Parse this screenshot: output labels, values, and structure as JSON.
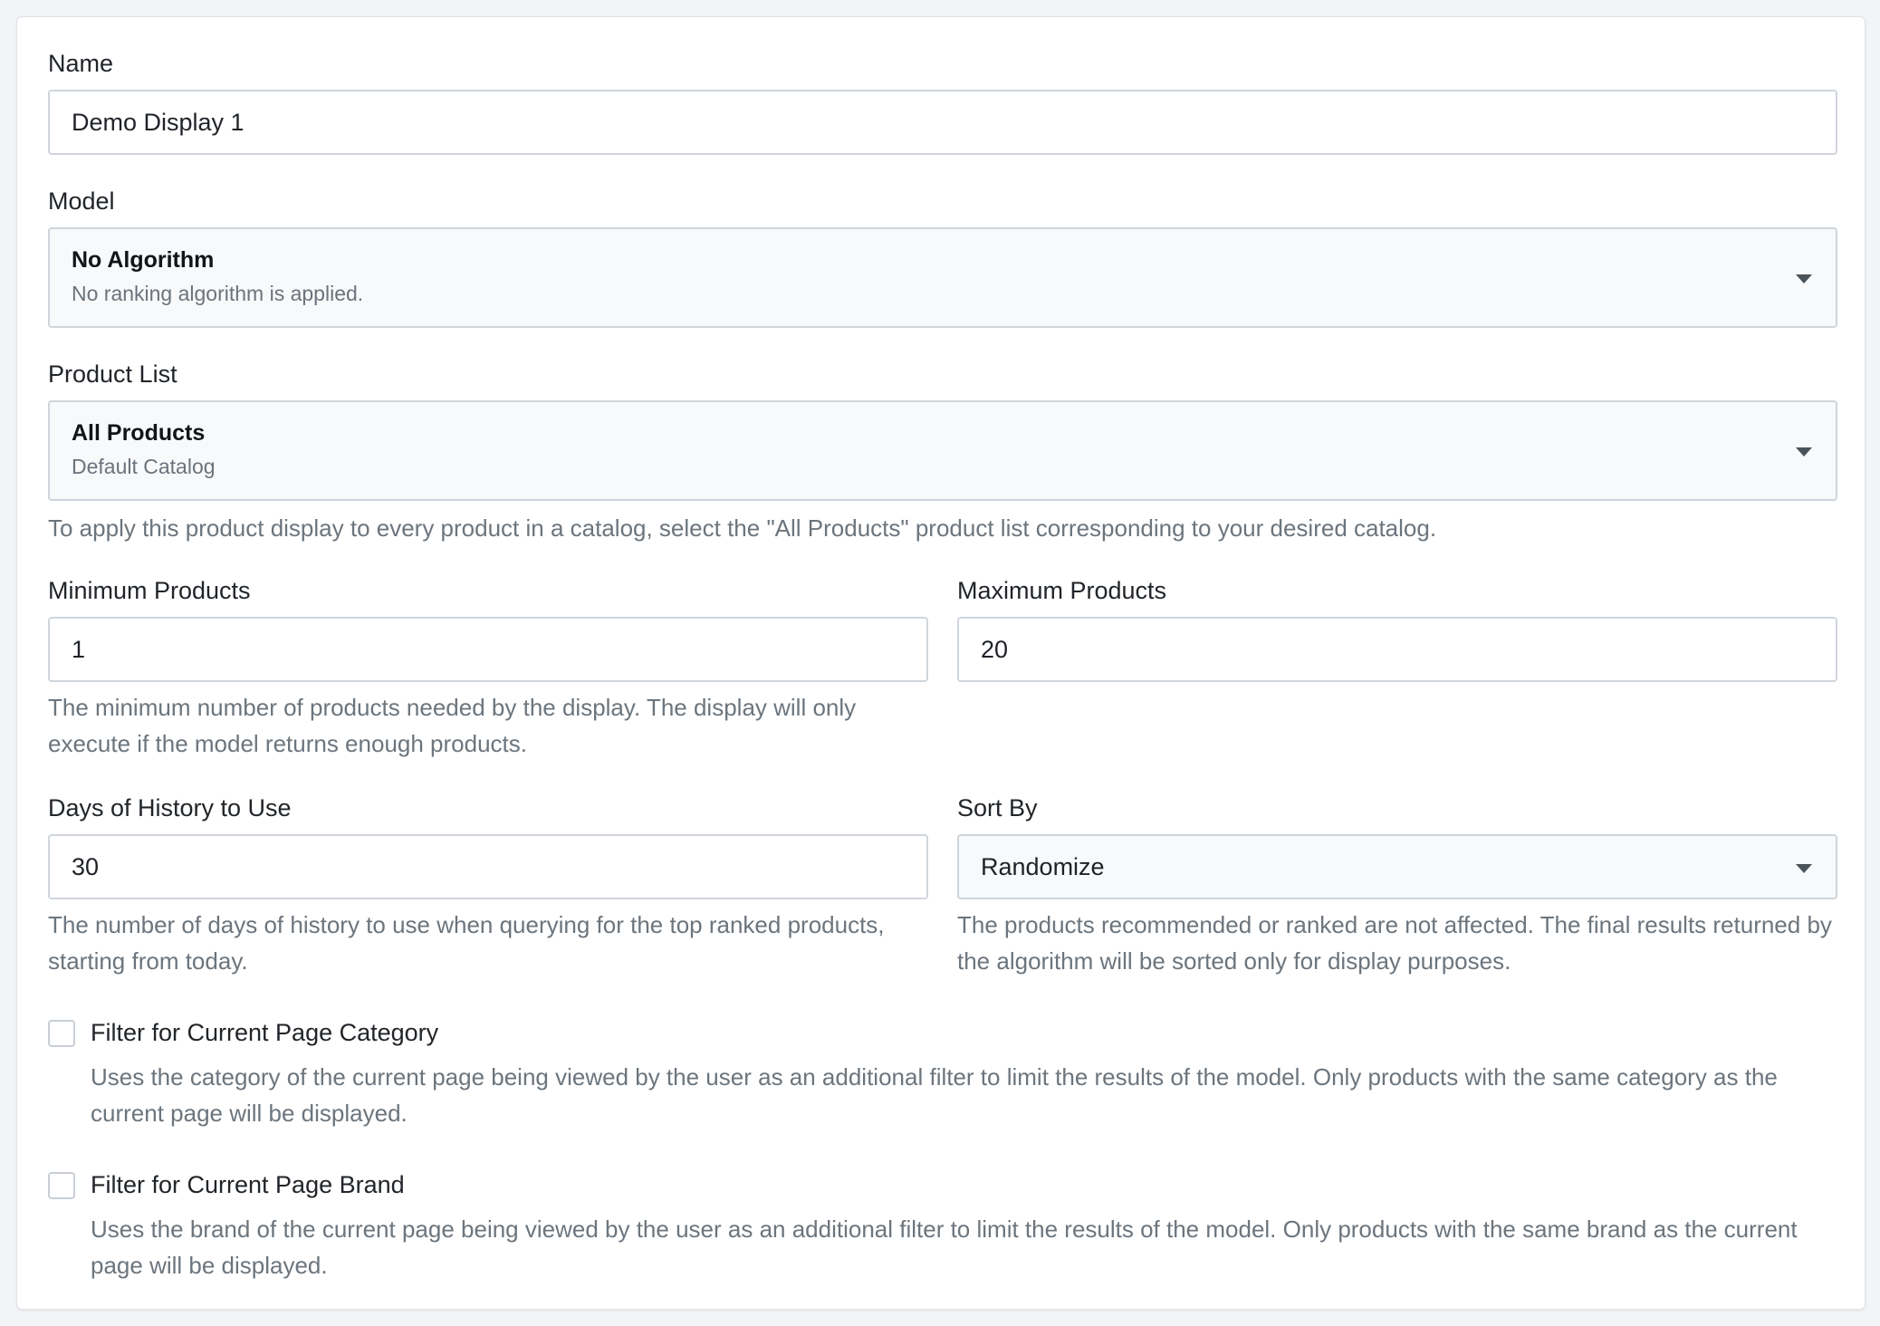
{
  "form": {
    "name": {
      "label": "Name",
      "value": "Demo Display 1"
    },
    "model": {
      "label": "Model",
      "selected_title": "No Algorithm",
      "selected_subtitle": "No ranking algorithm is applied."
    },
    "product_list": {
      "label": "Product List",
      "selected_title": "All Products",
      "selected_subtitle": "Default Catalog",
      "help": "To apply this product display to every product in a catalog, select the \"All Products\" product list corresponding to your desired catalog."
    },
    "min_products": {
      "label": "Minimum Products",
      "value": "1",
      "help": "The minimum number of products needed by the display. The display will only execute if the model returns enough products."
    },
    "max_products": {
      "label": "Maximum Products",
      "value": "20"
    },
    "days_history": {
      "label": "Days of History to Use",
      "value": "30",
      "help": "The number of days of history to use when querying for the top ranked products, starting from today."
    },
    "sort_by": {
      "label": "Sort By",
      "value": "Randomize",
      "help": "The products recommended or ranked are not affected. The final results returned by the algorithm will be sorted only for display purposes."
    },
    "filter_category": {
      "label": "Filter for Current Page Category",
      "checked": false,
      "help": "Uses the category of the current page being viewed by the user as an additional filter to limit the results of the model. Only products with the same category as the current page will be displayed."
    },
    "filter_brand": {
      "label": "Filter for Current Page Brand",
      "checked": false,
      "help": "Uses the brand of the current page being viewed by the user as an additional filter to limit the results of the model. Only products with the same brand as the current page will be displayed."
    }
  },
  "icons": {
    "dropdown": "chevron-down-icon",
    "checkbox": "checkbox-unchecked-icon"
  },
  "colors": {
    "border": "#cfd5db",
    "help_text": "#6c757d",
    "select_bg": "#f7f9fa"
  }
}
